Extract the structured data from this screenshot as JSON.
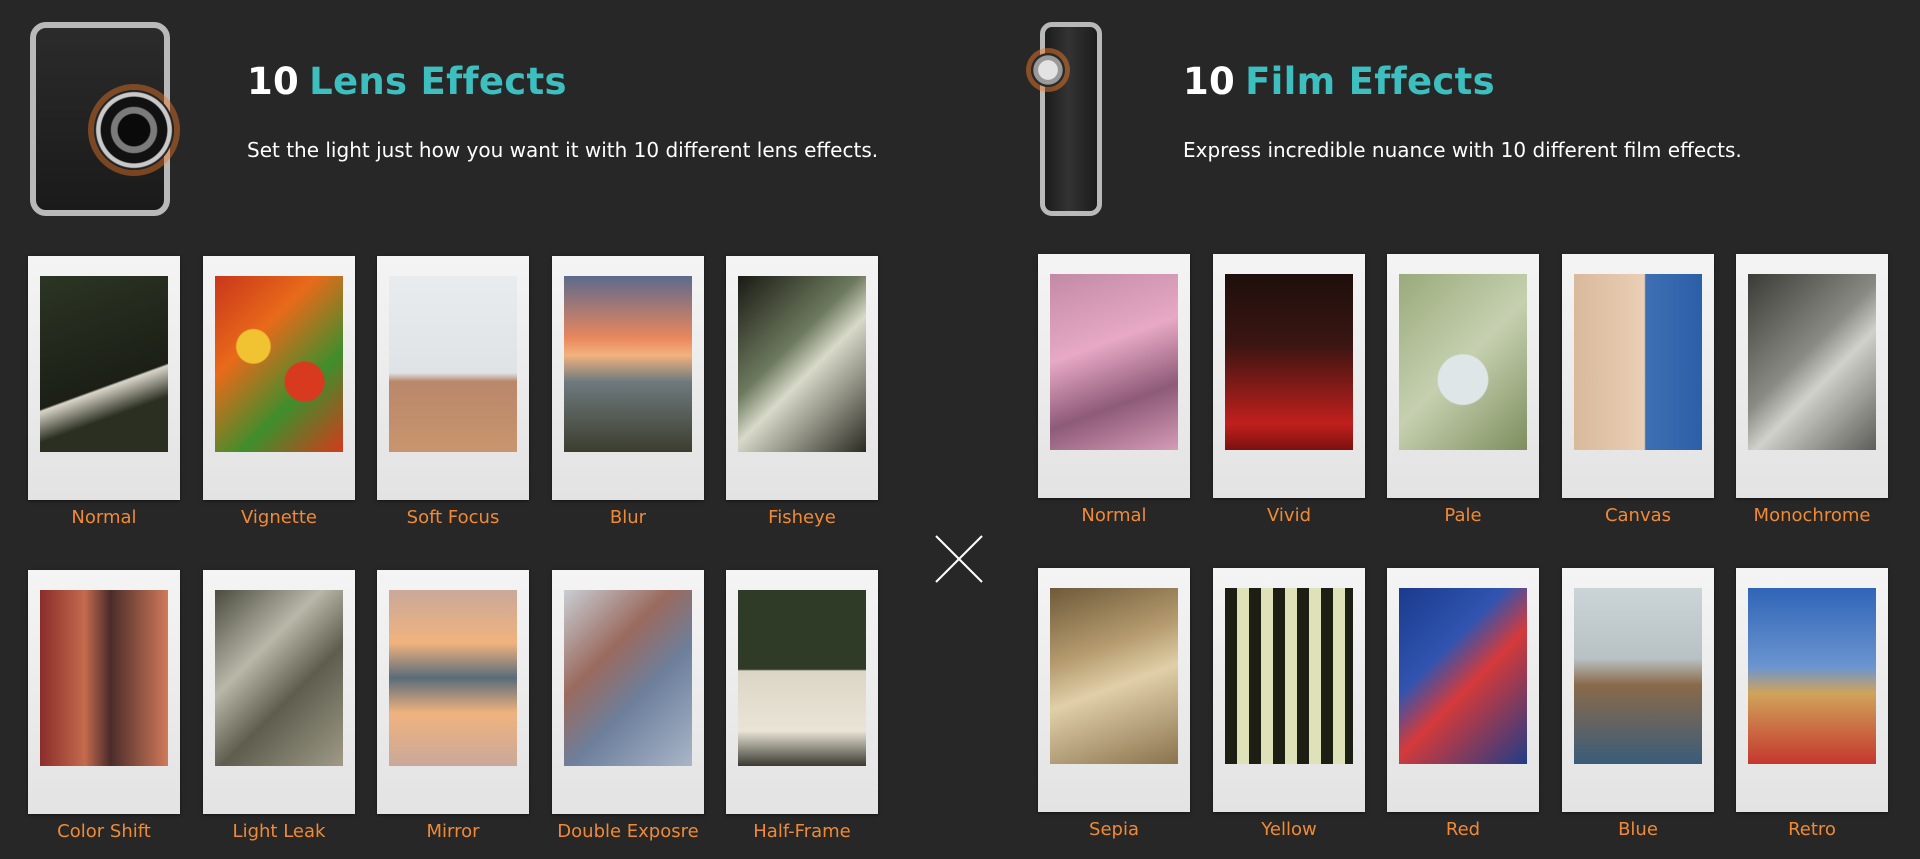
{
  "lens": {
    "heading_number": "10",
    "heading_accent": "Lens Effects",
    "description": "Set the light just how you want it with 10 different lens effects.",
    "effects": [
      "Normal",
      "Vignette",
      "Soft Focus",
      "Blur",
      "Fisheye",
      "Color Shift",
      "Light Leak",
      "Mirror",
      "Double Exposre",
      "Half-Frame"
    ]
  },
  "film": {
    "heading_number": "10",
    "heading_accent": "Film Effects",
    "description": "Express incredible nuance with 10 different film effects.",
    "effects": [
      "Normal",
      "Vivid",
      "Pale",
      "Canvas",
      "Monochrome",
      "Sepia",
      "Yellow",
      "Red",
      "Blue",
      "Retro"
    ]
  },
  "colors": {
    "background": "#272727",
    "accent_teal": "#3dbfc0",
    "label_orange": "#f08a35",
    "frame_white": "#f0f0f0"
  },
  "icons": {
    "divider": "close-x-icon",
    "lens_camera": "camera-front-image",
    "film_camera": "camera-side-image"
  }
}
